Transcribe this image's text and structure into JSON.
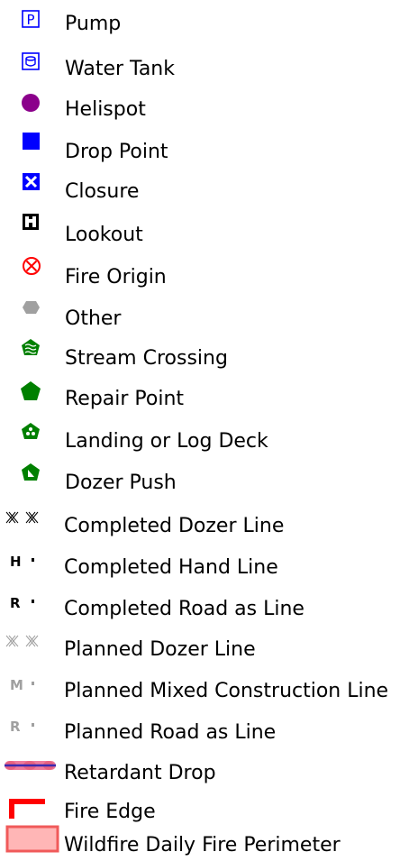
{
  "legend": {
    "items": [
      {
        "label": "Pump",
        "icon": "pump-icon"
      },
      {
        "label": "Water Tank",
        "icon": "water-tank-icon"
      },
      {
        "label": "Helispot",
        "icon": "helispot-icon"
      },
      {
        "label": "Drop Point",
        "icon": "drop-point-icon"
      },
      {
        "label": "Closure",
        "icon": "closure-icon"
      },
      {
        "label": "Lookout",
        "icon": "lookout-icon"
      },
      {
        "label": "Fire Origin",
        "icon": "fire-origin-icon"
      },
      {
        "label": "Other",
        "icon": "other-icon"
      },
      {
        "label": "Stream Crossing",
        "icon": "stream-crossing-icon"
      },
      {
        "label": "Repair Point",
        "icon": "repair-point-icon"
      },
      {
        "label": "Landing or Log Deck",
        "icon": "landing-log-deck-icon"
      },
      {
        "label": "Dozer Push",
        "icon": "dozer-push-icon"
      },
      {
        "label": "Completed Dozer Line",
        "icon": "completed-dozer-line-icon"
      },
      {
        "label": "Completed Hand Line",
        "icon": "completed-hand-line-icon",
        "glyph": "H"
      },
      {
        "label": "Completed Road as Line",
        "icon": "completed-road-line-icon",
        "glyph": "R"
      },
      {
        "label": "Planned Dozer Line",
        "icon": "planned-dozer-line-icon"
      },
      {
        "label": "Planned Mixed Construction Line",
        "icon": "planned-mixed-line-icon",
        "glyph": "M"
      },
      {
        "label": "Planned Road as Line",
        "icon": "planned-road-line-icon",
        "glyph": "R"
      },
      {
        "label": "Retardant Drop",
        "icon": "retardant-drop-icon"
      },
      {
        "label": "Fire Edge",
        "icon": "fire-edge-icon"
      },
      {
        "label": "Wildfire Daily Fire Perimeter",
        "icon": "fire-perimeter-icon"
      }
    ]
  },
  "colors": {
    "blue": "#0000ff",
    "purple": "#8b008b",
    "green": "#008000",
    "red": "#ff0000",
    "gray": "#a0a0a0",
    "pink_fill": "#ffb6b6"
  }
}
